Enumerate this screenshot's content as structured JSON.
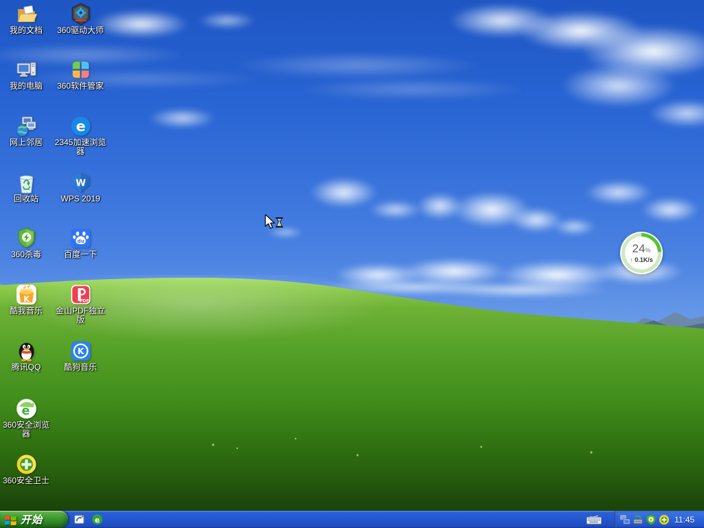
{
  "desktop": {
    "cursor_state": "busy-arrow-with-hourglass",
    "icons": [
      {
        "id": "my-documents",
        "label": "我的文档"
      },
      {
        "id": "360-driver-master",
        "label": "360驱动大师"
      },
      {
        "id": "my-computer",
        "label": "我的电脑"
      },
      {
        "id": "360-software-manager",
        "label": "360软件管家"
      },
      {
        "id": "network-places",
        "label": "网上邻居"
      },
      {
        "id": "2345-browser",
        "label": "2345加速浏览器"
      },
      {
        "id": "recycle-bin",
        "label": "回收站"
      },
      {
        "id": "wps-2019",
        "label": "WPS 2019"
      },
      {
        "id": "360-antivirus",
        "label": "360杀毒"
      },
      {
        "id": "baidu-search",
        "label": "百度一下"
      },
      {
        "id": "kuwo-music",
        "label": "酷我音乐"
      },
      {
        "id": "kingsoft-pdf",
        "label": "金山PDF独立版"
      },
      {
        "id": "tencent-qq",
        "label": "腾讯QQ"
      },
      {
        "id": "kugou-music",
        "label": "酷狗音乐"
      },
      {
        "id": "360-browser",
        "label": "360安全浏览器"
      },
      {
        "id": "360-safeguard",
        "label": "360安全卫士"
      }
    ]
  },
  "float_widget": {
    "percent": "24",
    "percent_unit": "%",
    "upload_arrow": "↑",
    "upload_speed": "0.1K/s"
  },
  "taskbar": {
    "start_label": "开始",
    "clock": "11:45",
    "quick_launch": [
      {
        "id": "show-desktop"
      },
      {
        "id": "360-browser-quick"
      }
    ],
    "tray_icons": [
      {
        "id": "input-keyboard"
      },
      {
        "id": "network-status"
      },
      {
        "id": "driver-master-tray"
      },
      {
        "id": "360-antivirus-tray"
      },
      {
        "id": "360-safeguard-tray"
      }
    ]
  },
  "colors": {
    "sky_top": "#1e56c4",
    "grass_mid": "#418d1b",
    "taskbar_blue": "#2456cf",
    "start_green": "#3e9a31",
    "widget_progress": "#54c32f",
    "widget_arrow_blue": "#1e88e5"
  }
}
